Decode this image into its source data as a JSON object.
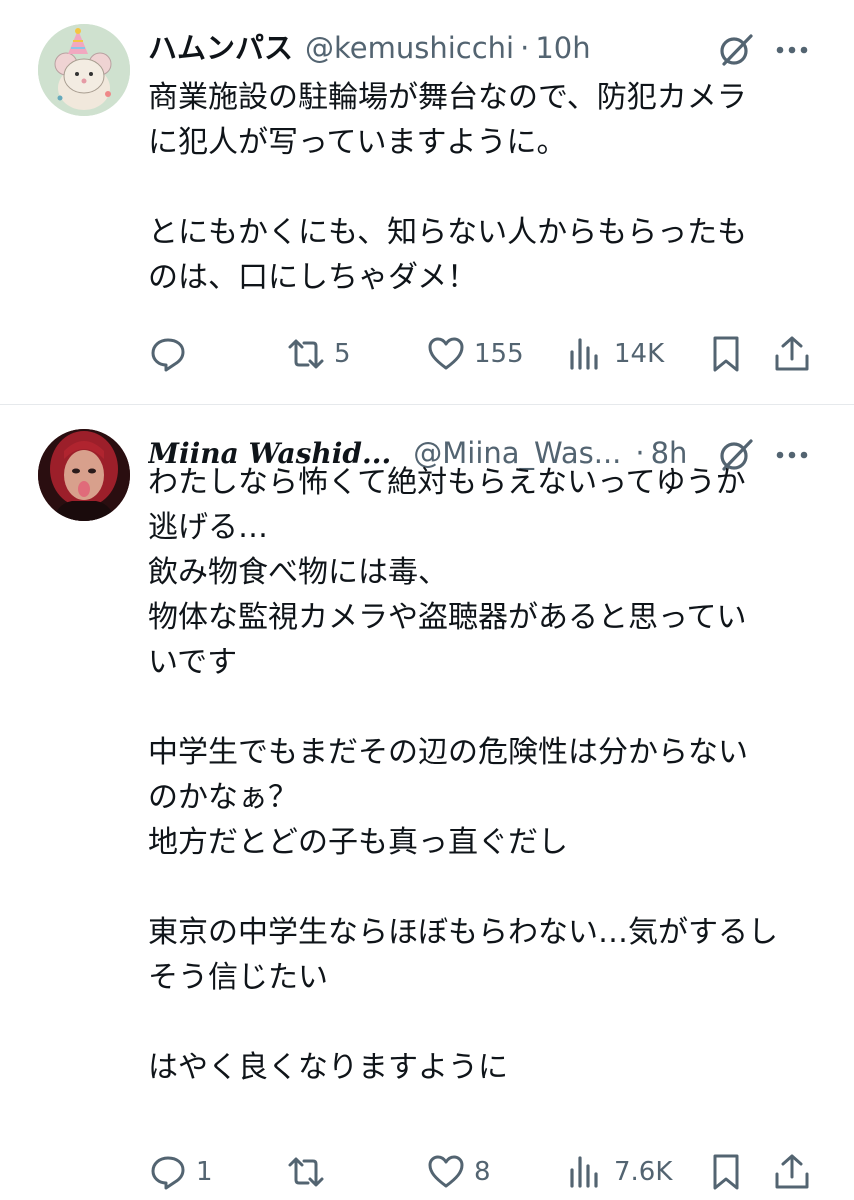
{
  "tweets": [
    {
      "display_name": "ハムンパス",
      "handle": "@kemushicchi",
      "separator": "·",
      "time": "10h",
      "avatar_icon": "party-hat-mouse-avatar",
      "lines": [
        "商業施設の駐輪場が舞台なので、防犯カメラ",
        "に犯人が写っていますように。",
        "",
        "とにもかくにも、知らない人からもらったも",
        "のは、口にしちゃダメ！"
      ],
      "reply_count": "",
      "retweet_count": "5",
      "like_count": "155",
      "view_count": "14K"
    },
    {
      "display_name": "Miina Washid...",
      "handle": "@Miina_Was...",
      "separator": "·",
      "time": "8h",
      "avatar_icon": "red-hair-portrait-avatar",
      "lines": [
        "わたしなら怖くて絶対もらえないってゆうか",
        "逃げる…",
        "飲み物食べ物には毒、",
        "物体な監視カメラや盗聴器があると思ってい",
        "いです",
        "",
        "中学生でもまだその辺の危険性は分からない",
        "のかなぁ？",
        "地方だとどの子も真っ直ぐだし",
        "",
        "東京の中学生ならほぼもらわない…気がするし",
        "そう信じたい",
        "",
        "はやく良くなりますように"
      ],
      "reply_count": "1",
      "retweet_count": "",
      "like_count": "8",
      "view_count": "7.6K"
    }
  ],
  "colors": {
    "text_primary": "#0f1419",
    "text_secondary": "#536471",
    "divider": "#e6e9ec"
  }
}
